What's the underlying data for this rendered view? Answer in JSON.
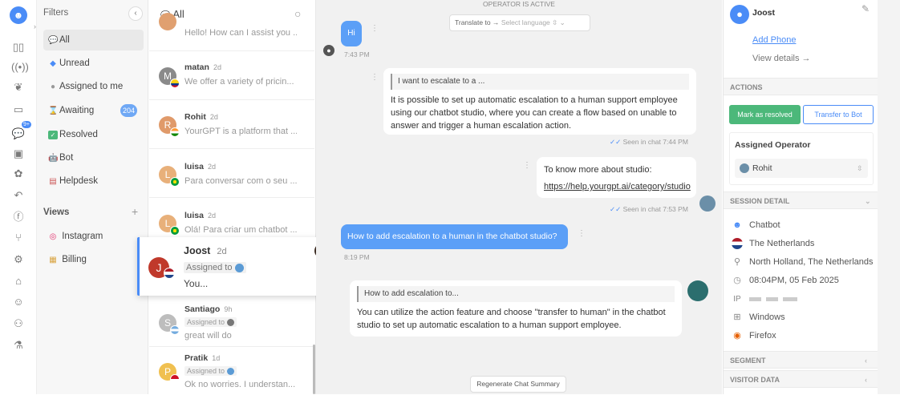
{
  "rail": {
    "icons": [
      "bot-logo-icon",
      "dashboard-icon",
      "broadcast-icon",
      "brain-icon",
      "book-icon",
      "chat-icon",
      "contacts-icon",
      "puzzle-icon",
      "undo-icon",
      "file-icon",
      "flow-icon",
      "gear-icon",
      "robot-icon",
      "user-check-icon",
      "users-icon",
      "flask-icon"
    ],
    "chat_badge": "9+"
  },
  "filters": {
    "title": "Filters",
    "items": [
      {
        "label": "All",
        "icon": "chat-bubble-icon"
      },
      {
        "label": "Unread",
        "icon": "inbox-icon"
      },
      {
        "label": "Assigned to me",
        "icon": "person-icon"
      },
      {
        "label": "Awaiting",
        "icon": "hourglass-icon",
        "badge": "204"
      },
      {
        "label": "Resolved",
        "icon": "check-icon"
      },
      {
        "label": "Bot",
        "icon": "bot-icon"
      },
      {
        "label": "Helpdesk",
        "icon": "helpdesk-icon"
      }
    ],
    "views_title": "Views",
    "views_add": "+",
    "views": [
      {
        "label": "Instagram",
        "icon": "instagram-icon"
      },
      {
        "label": "Billing",
        "icon": "billing-icon"
      }
    ]
  },
  "list": {
    "title": "All",
    "conversations": [
      {
        "name": "",
        "time": "",
        "preview": "Hello! How can I assist you ...",
        "initial": "",
        "color": "#e0a070"
      },
      {
        "name": "matan",
        "time": "2d",
        "preview": "We offer a variety of pricin...",
        "initial": "M",
        "color": "#8a8a8a",
        "flag": "colombia"
      },
      {
        "name": "Rohit",
        "time": "2d",
        "preview": "YourGPT is a platform that ...",
        "initial": "R",
        "color": "#e09a6a",
        "flag": "india"
      },
      {
        "name": "luisa",
        "time": "2d",
        "preview": "Para conversar com o seu ...",
        "initial": "L",
        "color": "#e8b07a",
        "flag": "brazil"
      },
      {
        "name": "luisa",
        "time": "2d",
        "preview": "Olá! Para criar um chatbot ...",
        "initial": "L",
        "color": "#e8b07a",
        "flag": "brazil"
      },
      {
        "name": "Santiago",
        "time": "9h",
        "preview": "great will do",
        "initial": "S",
        "color": "#bdbdbd",
        "assigned": "Assigned to",
        "flag": "argentina"
      },
      {
        "name": "Pratik",
        "time": "1d",
        "preview": "Ok no worries. I understan...",
        "initial": "P",
        "color": "#f0c050",
        "assigned": "Assigned to",
        "flag": "indonesia"
      }
    ],
    "drag_card": {
      "name": "Joost",
      "time": "2d",
      "assigned": "Assigned to",
      "preview": "You...",
      "initial": "J",
      "color": "#c0392b"
    }
  },
  "chat": {
    "operator_status": "OPERATOR IS ACTIVE",
    "translate_label": "Translate to →",
    "translate_placeholder": "Select language",
    "msg1": {
      "text": "Hi",
      "time": "7:43 PM"
    },
    "msg2": {
      "quote": "I want to escalate to a ...",
      "text": "It is possible to set up automatic escalation to a human support employee using our chatbot studio, where you can create a flow based on unable to answer and trigger a human escalation action.",
      "seen": "Seen in chat  7:44 PM"
    },
    "msg3": {
      "text": "To know more about studio:",
      "link": "https://help.yourgpt.ai/category/studio",
      "seen": "Seen in chat  7:53 PM"
    },
    "msg4": {
      "text": "How to add escalation to a human in the chatbot studio?",
      "time": "8:19 PM"
    },
    "msg5": {
      "quote": "How to add escalation to...",
      "text": "You can utilize the action feature and choose \"transfer to human\" in the chatbot studio to set up automatic escalation to a human support employee."
    },
    "summary_button": "Regenerate Chat Summary"
  },
  "right": {
    "user_name": "Joost",
    "add_phone": "Add Phone",
    "view_details": "View details →",
    "actions_title": "ACTIONS",
    "resolve_button": "Mark as resolved",
    "transfer_button": "Transfer to Bot",
    "assigned_title": "Assigned Operator",
    "assigned_value": "Rohit",
    "session_title": "SESSION DETAIL",
    "session": [
      {
        "icon": "bot-icon",
        "text": "Chatbot"
      },
      {
        "icon": "flag-icon",
        "text": "The Netherlands"
      },
      {
        "icon": "location-icon",
        "text": "North Holland, The Netherlands"
      },
      {
        "icon": "clock-icon",
        "text": "08:04PM, 05 Feb 2025"
      },
      {
        "icon": "ip-icon",
        "text": "IP"
      },
      {
        "icon": "windows-icon",
        "text": "Windows"
      },
      {
        "icon": "firefox-icon",
        "text": "Firefox"
      }
    ],
    "segment_title": "SEGMENT",
    "visitor_title": "VISITOR DATA"
  },
  "colors": {
    "accent": "#4a8cf7",
    "green": "#4cb87a",
    "bubble_user": "#5b9ff7"
  }
}
